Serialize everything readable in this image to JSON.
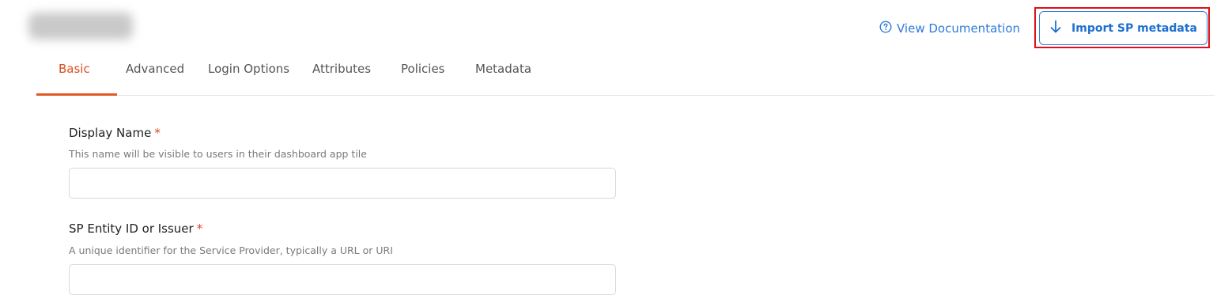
{
  "header": {
    "doc_link_label": "View Documentation",
    "import_button_label": "Import SP metadata"
  },
  "tabs": [
    {
      "label": "Basic",
      "active": true
    },
    {
      "label": "Advanced",
      "active": false
    },
    {
      "label": "Login Options",
      "active": false
    },
    {
      "label": "Attributes",
      "active": false
    },
    {
      "label": "Policies",
      "active": false
    },
    {
      "label": "Metadata",
      "active": false
    }
  ],
  "form": {
    "display_name": {
      "label": "Display Name",
      "required_mark": "*",
      "help": "This name will be visible to users in their dashboard app tile",
      "value": "",
      "placeholder": ""
    },
    "sp_entity_id": {
      "label": "SP Entity ID or Issuer",
      "required_mark": "*",
      "help": "A unique identifier for the Service Provider, typically a URL or URI",
      "value": "",
      "placeholder": ""
    }
  },
  "colors": {
    "accent_blue": "#2f7bd8",
    "active_tab": "#d94f1e",
    "highlight_red": "#e0101a",
    "required_red": "#e0402b"
  },
  "icons": {
    "doc_link": "help-circle-icon",
    "import_button": "arrow-down-icon"
  }
}
